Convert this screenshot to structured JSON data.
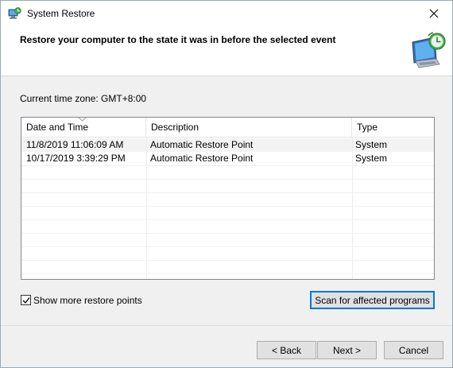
{
  "window": {
    "title": "System Restore",
    "icon": "system-restore-icon"
  },
  "header": {
    "heading": "Restore your computer to the state it was in before the selected event",
    "icon": "restore-monitor-icon"
  },
  "timezone": {
    "text": "Current time zone: GMT+8:00"
  },
  "table": {
    "columns": [
      "Date and Time",
      "Description",
      "Type"
    ],
    "sorted_column": "Date and Time",
    "rows": [
      {
        "date": "11/8/2019 11:06:09 AM",
        "description": "Automatic Restore Point",
        "type": "System"
      },
      {
        "date": "10/17/2019 3:39:29 PM",
        "description": "Automatic Restore Point",
        "type": "System"
      }
    ]
  },
  "options": {
    "show_more_label": "Show more restore points",
    "show_more_checked": true
  },
  "buttons": {
    "scan": "Scan for affected programs",
    "back": "< Back",
    "next": "Next >",
    "cancel": "Cancel"
  },
  "colors": {
    "accent": "#0078d7",
    "window_bg": "#f0f0f0",
    "button_bg": "#e1e1e1"
  }
}
